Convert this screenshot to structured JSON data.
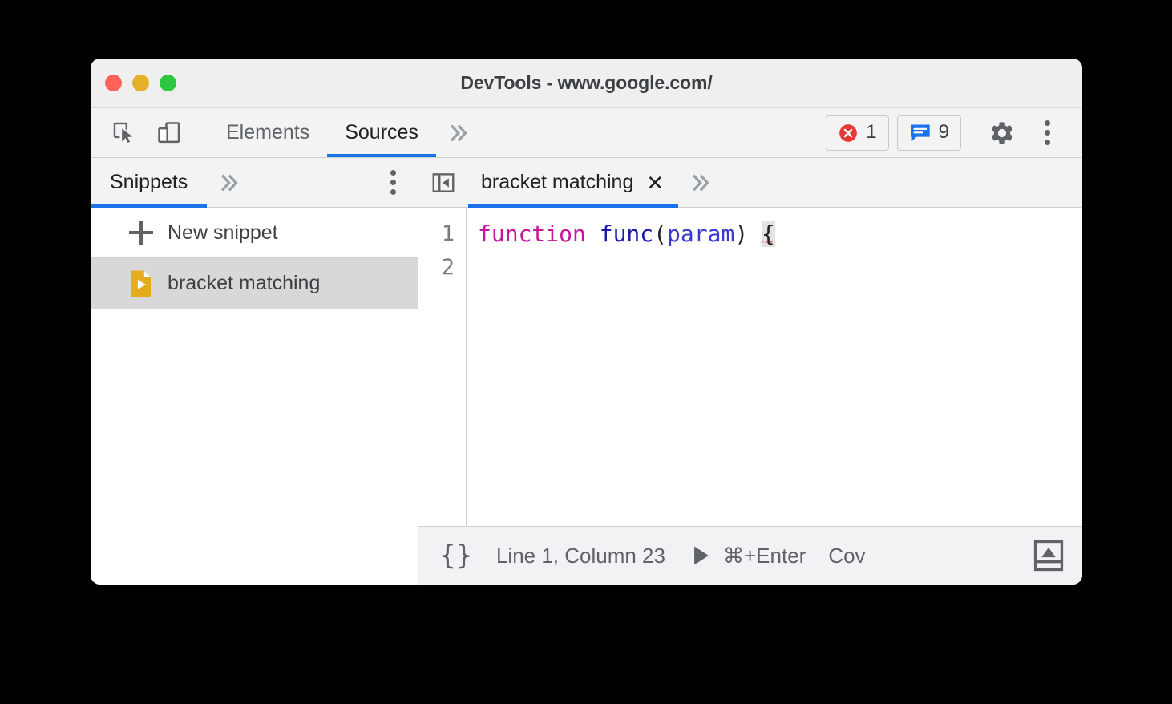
{
  "window": {
    "title": "DevTools - www.google.com/",
    "traffic_lights": [
      "close",
      "minimize",
      "maximize"
    ]
  },
  "main_toolbar": {
    "inspect_icon": "inspect-element-icon",
    "device_icon": "device-toolbar-icon",
    "tabs": [
      {
        "label": "Elements",
        "active": false
      },
      {
        "label": "Sources",
        "active": true
      }
    ],
    "more_tabs_icon": "chevron-double-right-icon",
    "error_badge": {
      "icon": "error-circle-icon",
      "count": "1",
      "color": "#e53935"
    },
    "message_badge": {
      "icon": "message-bubble-icon",
      "count": "9",
      "color": "#1a73e8"
    },
    "settings_icon": "gear-icon",
    "more_options_icon": "dots-vertical-icon"
  },
  "navigator": {
    "tabs": [
      {
        "label": "Snippets",
        "active": true
      }
    ],
    "more_tabs_icon": "chevron-double-right-icon",
    "more_options_icon": "dots-vertical-icon",
    "new_snippet_label": "New snippet",
    "items": [
      {
        "label": "bracket matching",
        "icon": "snippet-file-icon",
        "selected": true
      }
    ]
  },
  "editor": {
    "collapse_icon": "collapse-sidebar-icon",
    "tab": {
      "label": "bracket matching",
      "close_icon": "close-icon"
    },
    "more_tabs_icon": "chevron-double-right-icon",
    "line_numbers": [
      "1",
      "2"
    ],
    "code": {
      "line1": {
        "keyword": "function",
        "space": " ",
        "fn_name": "func",
        "open_paren": "(",
        "param": "param",
        "close_paren": ")",
        "gap": " ",
        "brace": "{"
      },
      "line2": ""
    },
    "syntax_colors": {
      "keyword": "#c5169c",
      "function": "#1a1aa6",
      "parameter": "#3b3bd0",
      "punctuation": "#202124",
      "bracket_match_bg": "#e3e3e3",
      "error_squiggle": "#e8705a"
    },
    "annotation": {
      "shape": "rounded-rect-outline",
      "color": "#1245e8",
      "target": "{"
    }
  },
  "status_bar": {
    "pretty_print_label": "{}",
    "cursor_position": "Line 1, Column 23",
    "run_icon": "play-triangle-icon",
    "run_shortcut": "⌘+Enter",
    "coverage_label": "Cov",
    "drawer_icon": "show-drawer-icon"
  }
}
